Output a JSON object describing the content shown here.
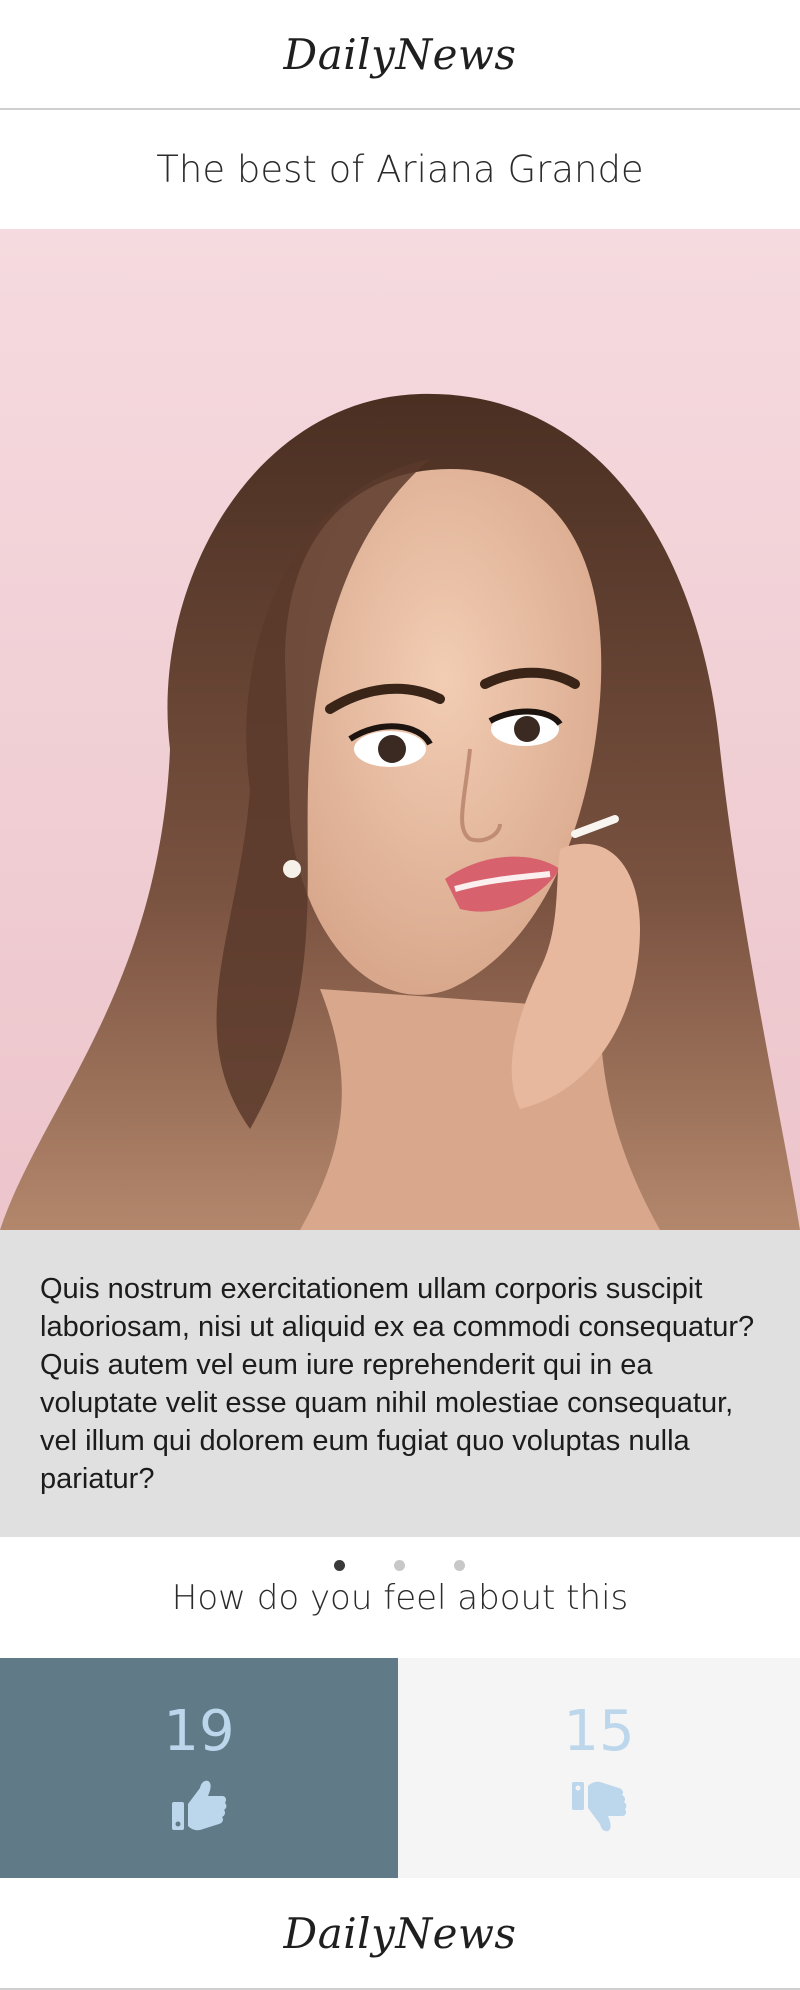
{
  "header": {
    "logo_text": "DailyNews"
  },
  "article": {
    "title": "The best of Ariana Grande",
    "body": "Quis nostrum exercitationem ullam corporis suscipit laboriosam, nisi ut aliquid ex ea commodi consequatur? Quis autem vel eum iure reprehenderit qui in ea voluptate velit esse quam nihil molestiae consequatur, vel illum qui dolorem eum fugiat quo voluptas nulla pariatur?"
  },
  "carousel": {
    "slide_count": 3,
    "active_index": 0
  },
  "feedback": {
    "question": "How do you feel about this",
    "like": {
      "count": "19",
      "icon": "thumbs-up-icon"
    },
    "dislike": {
      "count": "15",
      "icon": "thumbs-down-icon"
    }
  },
  "colors": {
    "like_bg": "#607a87",
    "dislike_bg": "#f5f5f5",
    "count_color": "#bcd6ec",
    "textbox_bg": "#e0e0e0"
  },
  "footer": {
    "logo_text": "DailyNews"
  }
}
